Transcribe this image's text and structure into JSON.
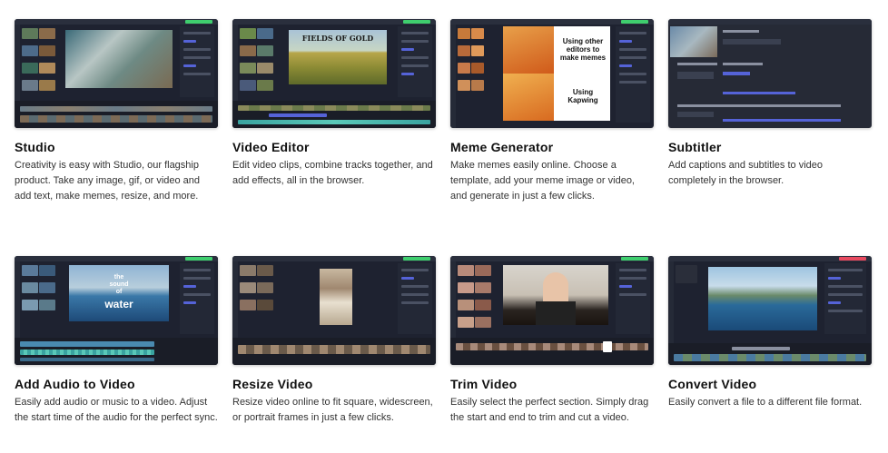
{
  "cards": [
    {
      "title": "Studio",
      "desc": "Creativity is easy with Studio, our flagship product. Take any image, gif, or video and add text, make memes, resize, and more."
    },
    {
      "title": "Video Editor",
      "desc": "Edit video clips, combine tracks together, and add effects, all in the browser.",
      "canvas_text": "FIELDS OF GOLD"
    },
    {
      "title": "Meme Generator",
      "desc": "Make memes easily online. Choose a template, add your meme image or video, and generate in just a few clicks.",
      "meme_top": "Using other editors to make memes",
      "meme_bottom": "Using Kapwing"
    },
    {
      "title": "Subtitler",
      "desc": "Add captions and subtitles to video completely in the browser."
    },
    {
      "title": "Add Audio to Video",
      "desc": "Easily add audio or music to a video. Adjust the start time of the audio for the perfect sync.",
      "canvas_text_1": "the",
      "canvas_text_2": "sound",
      "canvas_text_3": "of",
      "canvas_text_4": "water"
    },
    {
      "title": "Resize Video",
      "desc": "Resize video online to fit square, widescreen, or portrait frames in just a few clicks."
    },
    {
      "title": "Trim Video",
      "desc": "Easily select the perfect section. Simply drag the start and end to trim and cut a video."
    },
    {
      "title": "Convert Video",
      "desc": "Easily convert a file to a different file format."
    }
  ],
  "colors": {
    "editor_bg": "#1e2230",
    "accent_green": "#3fce6e",
    "accent_blue": "#5563d8",
    "accent_red": "#e84a5f"
  }
}
